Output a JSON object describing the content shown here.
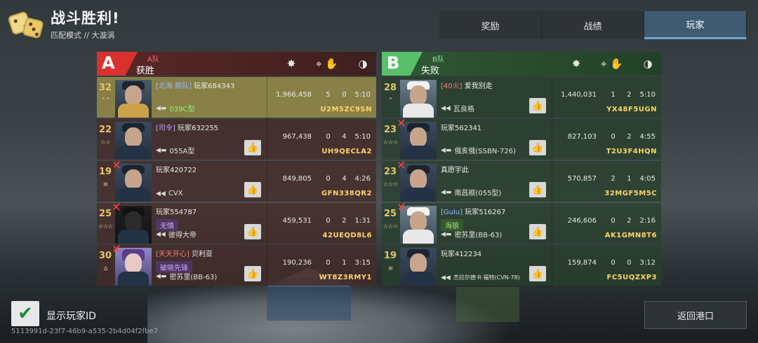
{
  "header": {
    "title": "战斗胜利!",
    "mode": "匹配模式",
    "separator": "//",
    "map": "大漩涡"
  },
  "tabs": [
    {
      "label": "奖励",
      "active": false
    },
    {
      "label": "战绩",
      "active": false
    },
    {
      "label": "玩家",
      "active": true
    }
  ],
  "teamA": {
    "letter": "A",
    "name": "A队",
    "result": "获胜",
    "color": "#d9312e",
    "rows": [
      {
        "level": "32",
        "clan": "[北海.舰队]",
        "player": "玩家684343",
        "tag": "",
        "ship": "039C型",
        "damage": "1,966,458",
        "kills": "5",
        "assists": "0",
        "time": "5:10",
        "pid": "U2M5ZC9SN",
        "dead": false,
        "highlight": true
      },
      {
        "level": "22",
        "clan": "[司令]",
        "player": "玩家632255",
        "tag": "",
        "ship": "055A型",
        "damage": "967,438",
        "kills": "0",
        "assists": "4",
        "time": "5:10",
        "pid": "UH9QECLA2",
        "dead": false,
        "highlight": false
      },
      {
        "level": "19",
        "clan": "",
        "player": "玩家420722",
        "tag": "",
        "ship": "CVX",
        "damage": "849,805",
        "kills": "0",
        "assists": "4",
        "time": "4:26",
        "pid": "GFN338QR2",
        "dead": true,
        "highlight": false
      },
      {
        "level": "25",
        "clan": "",
        "player": "玩家554787",
        "tag": "无情",
        "ship": "彼得大帝",
        "damage": "459,531",
        "kills": "0",
        "assists": "2",
        "time": "1:31",
        "pid": "42UEQD8L6",
        "dead": true,
        "highlight": false
      },
      {
        "level": "30",
        "clan": "[天天开心]",
        "player": "贝利亚",
        "tag": "破晓先锋",
        "ship": "密苏里(BB-63)",
        "damage": "190,236",
        "kills": "0",
        "assists": "1",
        "time": "3:15",
        "pid": "WT8Z3RMY1",
        "dead": true,
        "highlight": false
      }
    ]
  },
  "teamB": {
    "letter": "B",
    "name": "B队",
    "result": "失败",
    "color": "#58c06a",
    "rows": [
      {
        "level": "28",
        "clan": "[40火]",
        "player": "爱我别走",
        "tag": "",
        "ship": "瓦良格",
        "damage": "1,440,031",
        "kills": "1",
        "assists": "2",
        "time": "5:10",
        "pid": "YX48F5UGN",
        "dead": false
      },
      {
        "level": "23",
        "clan": "",
        "player": "玩家562341",
        "tag": "",
        "ship": "俄亥俄(SSBN-726)",
        "damage": "827,103",
        "kills": "0",
        "assists": "2",
        "time": "4:55",
        "pid": "T2U3F4HQN",
        "dead": true
      },
      {
        "level": "23",
        "clan": "",
        "player": "真愿宇此",
        "tag": "",
        "ship": "南昌舰(055型)",
        "damage": "570,857",
        "kills": "2",
        "assists": "1",
        "time": "4:05",
        "pid": "32MGF5M5C",
        "dead": true
      },
      {
        "level": "25",
        "clan": "[Gulu]",
        "player": "玩家516267",
        "tag": "海狼",
        "ship": "密苏里(BB-63)",
        "damage": "246,606",
        "kills": "0",
        "assists": "2",
        "time": "2:16",
        "pid": "AK1GMN8T6",
        "dead": true
      },
      {
        "level": "19",
        "clan": "",
        "player": "玩家412234",
        "tag": "",
        "ship": "杰拉尔德·R·福特(CVN-78)",
        "damage": "159,874",
        "kills": "0",
        "assists": "0",
        "time": "3:12",
        "pid": "FC5UQZXP3",
        "dead": true
      }
    ]
  },
  "footer": {
    "show_id_label": "显示玩家ID",
    "show_id_checked": true,
    "uuid": "5113991d-23f7-46b9-a535-2b4d04f2fbe7",
    "back_label": "返回港口"
  }
}
